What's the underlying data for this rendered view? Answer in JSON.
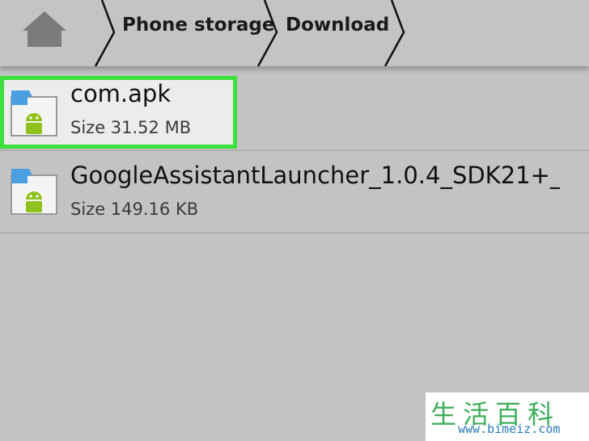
{
  "breadcrumb": {
    "home_icon": "home-icon",
    "items": [
      {
        "label": "Phone storage"
      },
      {
        "label": "Download"
      }
    ]
  },
  "files": [
    {
      "name": "com.apk",
      "size": "Size 31.52 MB",
      "icon": "apk-android-icon",
      "highlighted": true
    },
    {
      "name": "GoogleAssistantLauncher_1.0.4_SDK21+_",
      "size": "Size 149.16 KB",
      "icon": "apk-android-icon",
      "highlighted": false
    }
  ],
  "watermark": {
    "chars": "生活百科",
    "url": "www.bimeiz.com"
  },
  "colors": {
    "highlight": "#3de03a",
    "android_green": "#8fc21d",
    "tab_blue": "#4a9fe0"
  }
}
